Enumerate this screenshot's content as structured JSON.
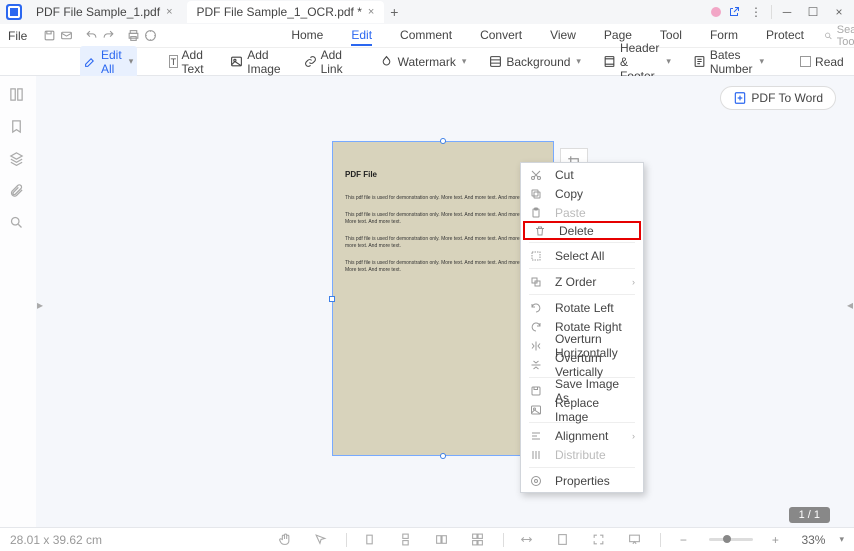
{
  "tabs": [
    {
      "label": "PDF File Sample_1.pdf"
    },
    {
      "label": "PDF File Sample_1_OCR.pdf *"
    }
  ],
  "toolbar1": {
    "file": "File",
    "search_placeholder": "Search Tools"
  },
  "menu": [
    "Home",
    "Edit",
    "Comment",
    "Convert",
    "View",
    "Page",
    "Tool",
    "Form",
    "Protect"
  ],
  "ribbon": {
    "edit_all": "Edit All",
    "add_text": "Add Text",
    "add_image": "Add Image",
    "add_link": "Add Link",
    "watermark": "Watermark",
    "background": "Background",
    "header_footer": "Header & Footer",
    "bates": "Bates Number",
    "read": "Read"
  },
  "pdf_to_word": "PDF To Word",
  "page": {
    "title": "PDF File",
    "p1": "This pdf file is used for demonstration only. More text. And more text. And more text.",
    "p2": "This pdf file is used for demonstration only. More text. And more text. And more text. More text. And more text.",
    "p3": "This pdf file is used for demonstration only. More text. And more text. And more text. And more text. And more text.",
    "p4": "This pdf file is used for demonstration only. More text. And more text. And more text. More text. And more text."
  },
  "context_menu": {
    "cut": "Cut",
    "copy": "Copy",
    "paste": "Paste",
    "delete": "Delete",
    "select_all": "Select All",
    "z_order": "Z Order",
    "rotate_left": "Rotate Left",
    "rotate_right": "Rotate Right",
    "overturn_h": "Overturn Horizontally",
    "overturn_v": "Overturn Vertically",
    "save_image_as": "Save Image As",
    "replace_image": "Replace Image",
    "alignment": "Alignment",
    "distribute": "Distribute",
    "properties": "Properties"
  },
  "page_indicator": "1 / 1",
  "statusbar": {
    "dims": "28.01 x 39.62 cm",
    "zoom": "33%"
  }
}
